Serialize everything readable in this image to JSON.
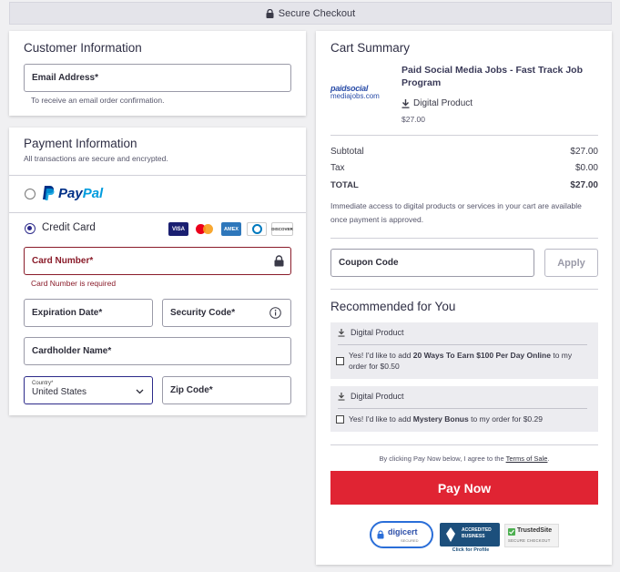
{
  "header": {
    "title": "Secure Checkout",
    "icon": "lock-icon"
  },
  "customer": {
    "title": "Customer Information",
    "email_label": "Email Address*",
    "email_hint": "To receive an email order confirmation."
  },
  "payment": {
    "title": "Payment Information",
    "subtitle": "All transactions are secure and encrypted.",
    "paypal_pay": "Pay",
    "paypal_pal": "Pal",
    "credit_label": "Credit Card",
    "card_logos": [
      "VISA",
      "mastercard",
      "AMEX",
      "Diners",
      "DISCOVER"
    ],
    "card_number_label": "Card Number*",
    "card_number_error": "Card Number is required",
    "expiration_label": "Expiration Date*",
    "security_label": "Security Code*",
    "cardholder_label": "Cardholder Name*",
    "country_small": "Country*",
    "country_value": "United States",
    "zip_label": "Zip Code*"
  },
  "cart": {
    "title": "Cart Summary",
    "product_name": "Paid Social Media Jobs - Fast Track Job Program",
    "product_type": "Digital Product",
    "product_price": "$27.00",
    "logo_text_1": "paidsocial",
    "logo_text_2": "mediajobs.com",
    "subtotal_label": "Subtotal",
    "subtotal_value": "$27.00",
    "tax_label": "Tax",
    "tax_value": "$0.00",
    "total_label": "TOTAL",
    "total_value": "$27.00",
    "access_note": "Immediate access to digital products or services in your cart are available once payment is approved.",
    "coupon_placeholder": "Coupon Code",
    "apply_label": "Apply",
    "recommended_title": "Recommended for You",
    "rec1_type": "Digital Product",
    "rec1_pre": "Yes! I'd like to add ",
    "rec1_bold": "20 Ways To Earn $100 Per Day Online",
    "rec1_post": " to my order for $0.50",
    "rec2_type": "Digital Product",
    "rec2_pre": "Yes! I'd like to add ",
    "rec2_bold": "Mystery Bonus",
    "rec2_post": " to my order for $0.29",
    "terms_pre": "By clicking Pay Now below, I agree to the ",
    "terms_link": "Terms of Sale",
    "terms_post": ".",
    "pay_now": "Pay Now",
    "badge_digicert": "digicert",
    "badge_digicert_sub": "SECURED",
    "badge_bbb": "ACCREDITED BUSINESS",
    "badge_bbb_sub": "Click for Profile",
    "badge_trusted": "TrustedSite",
    "badge_trusted_sub": "SECURE CHECKOUT"
  },
  "colors": {
    "accent": "#2c2a8a",
    "error": "#8a1c2a",
    "paynow": "#e02433"
  }
}
